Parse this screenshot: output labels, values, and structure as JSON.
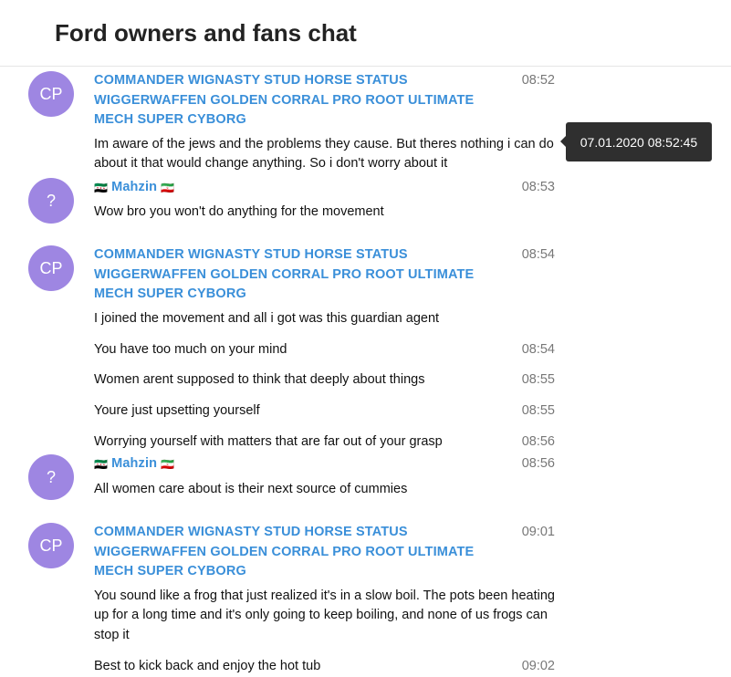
{
  "chat": {
    "title": "Ford owners and fans chat"
  },
  "tooltip": {
    "text": "07.01.2020 08:52:45"
  },
  "groups": [
    {
      "avatar": "CP",
      "sender": "COMMANDER WIGNASTY STUD HORSE STATUS WIGGERWAFFEN GOLDEN CORRAL PRO ROOT ULTIMATE MECH SUPER CYBORG",
      "time": "08:52",
      "messages": [
        {
          "text": "Im aware of the jews and the problems they cause. But theres nothing i can do about it that would change anything. So i don't worry about it",
          "time": ""
        }
      ]
    },
    {
      "avatar": "?",
      "sender": "Mahzin",
      "flag_left": "🇸🇾",
      "flag_right": "🇮🇷",
      "time": "08:53",
      "messages": [
        {
          "text": "Wow bro you won't do anything for the movement",
          "time": ""
        }
      ]
    },
    {
      "avatar": "CP",
      "sender": "COMMANDER WIGNASTY STUD HORSE STATUS WIGGERWAFFEN GOLDEN CORRAL PRO ROOT ULTIMATE MECH SUPER CYBORG",
      "time": "08:54",
      "messages": [
        {
          "text": "I joined the movement and all i got was this guardian agent",
          "time": ""
        },
        {
          "text": "You have too much on your mind",
          "time": "08:54"
        },
        {
          "text": "Women arent supposed to think that deeply about things",
          "time": "08:55"
        },
        {
          "text": "Youre just upsetting yourself",
          "time": "08:55"
        },
        {
          "text": "Worrying yourself with matters that are far out of your grasp",
          "time": "08:56"
        }
      ]
    },
    {
      "avatar": "?",
      "sender": "Mahzin",
      "flag_left": "🇸🇾",
      "flag_right": "🇮🇷",
      "time": "08:56",
      "messages": [
        {
          "text": "All women care about is their next source of cummies",
          "time": ""
        }
      ]
    },
    {
      "avatar": "CP",
      "sender": "COMMANDER WIGNASTY STUD HORSE STATUS WIGGERWAFFEN GOLDEN CORRAL PRO ROOT ULTIMATE MECH SUPER CYBORG",
      "time": "09:01",
      "messages": [
        {
          "text": "You sound like a frog that just realized it's in a slow boil. The pots been heating up for a long time and it's only going to keep boiling, and none of us frogs can stop it",
          "time": ""
        },
        {
          "text": "Best to kick back and enjoy the hot tub",
          "time": "09:02"
        }
      ]
    }
  ]
}
